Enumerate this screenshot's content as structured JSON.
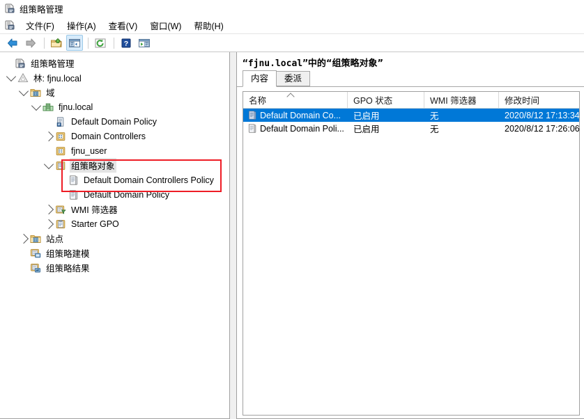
{
  "window": {
    "title": "组策略管理",
    "icon": "gpmc-icon"
  },
  "menubar": {
    "items": [
      {
        "label": "文件(F)",
        "name": "menu-file"
      },
      {
        "label": "操作(A)",
        "name": "menu-action"
      },
      {
        "label": "查看(V)",
        "name": "menu-view"
      },
      {
        "label": "窗口(W)",
        "name": "menu-window"
      },
      {
        "label": "帮助(H)",
        "name": "menu-help"
      }
    ]
  },
  "toolbar": {
    "buttons": [
      {
        "name": "back-button",
        "icon": "arrow-left-icon",
        "enabled": true
      },
      {
        "name": "forward-button",
        "icon": "arrow-right-icon",
        "enabled": false
      },
      {
        "name": "up-one-level-button",
        "icon": "folder-up-icon"
      },
      {
        "name": "show-hide-tree-button",
        "icon": "tree-pane-icon",
        "active": true
      },
      {
        "name": "refresh-button",
        "icon": "refresh-icon"
      },
      {
        "name": "help-button",
        "icon": "question-icon"
      },
      {
        "name": "export-list-button",
        "icon": "export-list-icon"
      }
    ]
  },
  "tree": {
    "root": {
      "label": "组策略管理",
      "icon": "gpmc-icon"
    },
    "nodes": [
      {
        "label": "林: fjnu.local",
        "icon": "forest-icon",
        "indent": 1,
        "expander": "down"
      },
      {
        "label": "域",
        "icon": "domains-folder-icon",
        "indent": 2,
        "expander": "down"
      },
      {
        "label": "fjnu.local",
        "icon": "domain-icon",
        "indent": 3,
        "expander": "down"
      },
      {
        "label": "Default Domain Policy",
        "icon": "gpo-link-icon",
        "indent": 4,
        "expander": "none"
      },
      {
        "label": "Domain Controllers",
        "icon": "ou-icon",
        "indent": 4,
        "expander": "right"
      },
      {
        "label": "fjnu_user",
        "icon": "ou-icon",
        "indent": 4,
        "expander": "none"
      },
      {
        "label": "组策略对象",
        "icon": "gpo-container-icon",
        "indent": 4,
        "expander": "down",
        "selected": true
      },
      {
        "label": "Default Domain Controllers Policy",
        "icon": "gpo-icon",
        "indent": 5,
        "expander": "none",
        "highlighted": true
      },
      {
        "label": "Default Domain Policy",
        "icon": "gpo-icon",
        "indent": 5,
        "expander": "none",
        "highlighted": true
      },
      {
        "label": "WMI 筛选器",
        "icon": "wmi-filter-icon",
        "indent": 4,
        "expander": "right"
      },
      {
        "label": "Starter GPO",
        "icon": "starter-gpo-icon",
        "indent": 4,
        "expander": "right"
      },
      {
        "label": "站点",
        "icon": "sites-icon",
        "indent": 2,
        "expander": "right"
      },
      {
        "label": "组策略建模",
        "icon": "modeling-icon",
        "indent": 2,
        "expander": "none"
      },
      {
        "label": "组策略结果",
        "icon": "results-icon",
        "indent": 2,
        "expander": "none"
      }
    ]
  },
  "right_pane": {
    "title_prefix": "“fjnu.local”",
    "title_suffix": "中的“组策略对象”",
    "tabs": [
      {
        "label": "内容",
        "name": "tab-contents",
        "active": true
      },
      {
        "label": "委派",
        "name": "tab-delegation",
        "active": false
      }
    ],
    "list": {
      "columns": [
        {
          "label": "名称",
          "name": "column-name",
          "sorted": "asc"
        },
        {
          "label": "GPO 状态",
          "name": "column-gpo-status"
        },
        {
          "label": "WMI 筛选器",
          "name": "column-wmi-filter"
        },
        {
          "label": "修改时间",
          "name": "column-modified-time"
        }
      ],
      "rows": [
        {
          "name": "Default Domain Co...",
          "gpo_status": "已启用",
          "wmi_filter": "无",
          "modified": "2020/8/12 17:13:34",
          "selected": true,
          "icon": "gpo-icon"
        },
        {
          "name": "Default Domain Poli...",
          "gpo_status": "已启用",
          "wmi_filter": "无",
          "modified": "2020/8/12 17:26:06",
          "selected": false,
          "icon": "gpo-icon"
        }
      ]
    }
  },
  "annotation": {
    "highlight_color": "#ee1c25",
    "selection_color": "#0078d7"
  }
}
